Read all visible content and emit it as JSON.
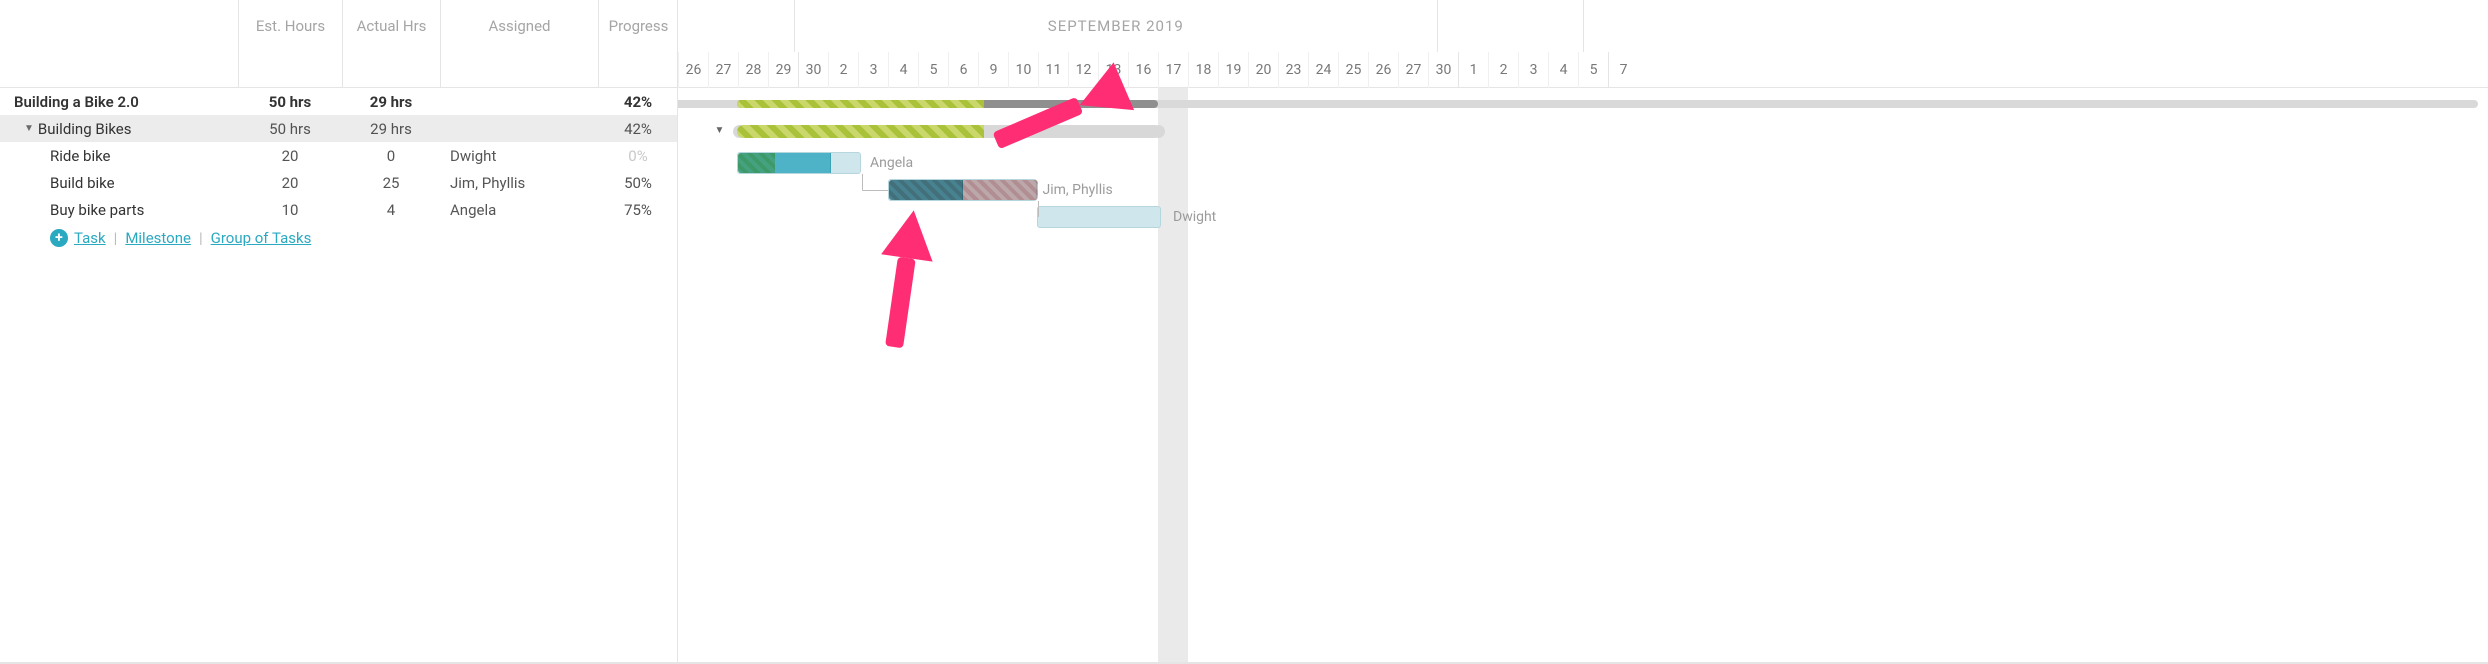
{
  "columns": {
    "est": "Est. Hours",
    "actual": "Actual Hrs",
    "assigned": "Assigned",
    "progress": "Progress"
  },
  "timeline": {
    "month_label": "SEPTEMBER 2019",
    "day_width": 30,
    "first_day_index": -1,
    "today_index": 17,
    "segments": [
      {
        "label": "",
        "days": 1,
        "boundary": false
      },
      {
        "label": "SEPTEMBER 2019",
        "days": 22,
        "days_visible_to_boundary": 22,
        "boundary": true
      },
      {
        "label": "",
        "days": 5,
        "boundary": true
      }
    ],
    "days": [
      "23",
      "26",
      "27",
      "28",
      "29",
      "30",
      "2",
      "3",
      "4",
      "5",
      "6",
      "9",
      "10",
      "11",
      "12",
      "13",
      "16",
      "17",
      "18",
      "19",
      "20",
      "23",
      "24",
      "25",
      "26",
      "27",
      "30",
      "1",
      "2",
      "3",
      "4",
      "5",
      "7"
    ],
    "month_boundary_at": [
      5,
      27,
      32
    ]
  },
  "project": {
    "name": "Building a Bike 2.0",
    "est": "50 hrs",
    "actual": "29 hrs",
    "assigned": "",
    "progress": "42%",
    "bar": {
      "start_index": 2.95,
      "end_index": 17,
      "progress_end_index": 11.2
    }
  },
  "group": {
    "name": "Building Bikes",
    "est": "50 hrs",
    "actual": "29 hrs",
    "assigned": "",
    "progress": "42%",
    "bar": {
      "start_index": 2.95,
      "end_index": 17.1,
      "progress_end_index": 11.2
    }
  },
  "tasks": [
    {
      "name": "Buy bike parts",
      "est": "10",
      "actual": "4",
      "assigned": "Angela",
      "progress": "75%",
      "bar": {
        "start_index": 2.95,
        "end_index": 7.1,
        "fill_frac": 0.75,
        "hatch_frac": 0.3,
        "style": "green"
      },
      "label_x_index": 7.4
    },
    {
      "name": "Build bike",
      "est": "20",
      "actual": "25",
      "assigned": "Jim, Phyllis",
      "progress": "50%",
      "bar": {
        "start_index": 8.0,
        "end_index": 12.95,
        "fill_frac": 0.5,
        "hatch_frac": 1.0,
        "style": "red"
      },
      "label_x_index": 13.15
    },
    {
      "name": "Ride bike",
      "est": "20",
      "actual": "0",
      "assigned": "Dwight",
      "progress": "0%",
      "progress_muted": true,
      "bar": {
        "start_index": 12.95,
        "end_index": 17.1,
        "fill_frac": 0.0,
        "hatch_frac": 0.0,
        "style": "none"
      },
      "label_x_index": 17.5
    }
  ],
  "add_links": {
    "task": "Task",
    "milestone": "Milestone",
    "group": "Group of Tasks"
  },
  "chart_data": {
    "type": "gantt",
    "title": "Building a Bike 2.0",
    "timeline_label": "SEPTEMBER 2019",
    "today": "2019-09-17",
    "visible_weekday_labels": [
      "23",
      "26",
      "27",
      "28",
      "29",
      "30",
      "2",
      "3",
      "4",
      "5",
      "6",
      "9",
      "10",
      "11",
      "12",
      "13",
      "16",
      "17",
      "18",
      "19",
      "20",
      "23",
      "24",
      "25",
      "26",
      "27",
      "30",
      "1",
      "2",
      "3",
      "4",
      "5",
      "7"
    ],
    "columns": [
      "Est. Hours",
      "Actual Hrs",
      "Assigned",
      "Progress"
    ],
    "summary": {
      "name": "Building a Bike 2.0",
      "est_hours": 50,
      "actual_hours": 29,
      "progress_pct": 42,
      "start": "2019-08-27",
      "end": "2019-09-17"
    },
    "groups": [
      {
        "name": "Building Bikes",
        "est_hours": 50,
        "actual_hours": 29,
        "progress_pct": 42,
        "start": "2019-08-27",
        "end": "2019-09-17"
      }
    ],
    "tasks": [
      {
        "name": "Buy bike parts",
        "group": "Building Bikes",
        "est_hours": 10,
        "actual_hours": 4,
        "assigned": [
          "Angela"
        ],
        "progress_pct": 75,
        "start": "2019-08-27",
        "end": "2019-09-03"
      },
      {
        "name": "Build bike",
        "group": "Building Bikes",
        "est_hours": 20,
        "actual_hours": 25,
        "assigned": [
          "Jim",
          "Phyllis"
        ],
        "progress_pct": 50,
        "start": "2019-09-04",
        "end": "2019-09-11",
        "over_allocated": true
      },
      {
        "name": "Ride bike",
        "group": "Building Bikes",
        "est_hours": 20,
        "actual_hours": 0,
        "assigned": [
          "Dwight"
        ],
        "progress_pct": 0,
        "start": "2019-09-11",
        "end": "2019-09-17"
      }
    ],
    "dependencies": [
      {
        "from": "Buy bike parts",
        "to": "Build bike"
      },
      {
        "from": "Build bike",
        "to": "Ride bike"
      }
    ]
  }
}
